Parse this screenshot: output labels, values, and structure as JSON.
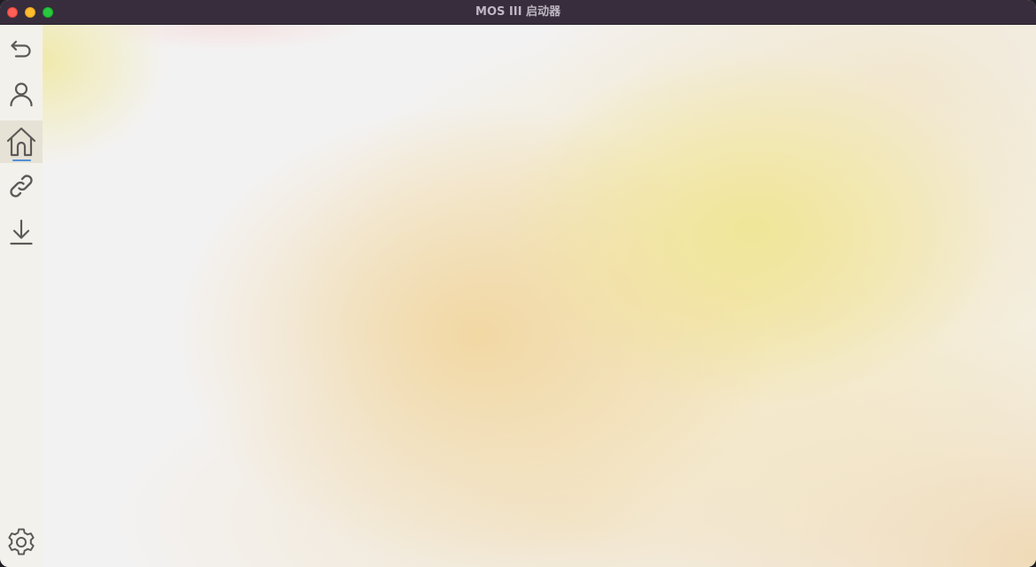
{
  "window": {
    "title": "MOS III 启动器"
  },
  "traffic_lights": {
    "close": "close-window",
    "minimize": "minimize-window",
    "zoom": "zoom-window"
  },
  "sidebar": {
    "items": [
      {
        "id": "back",
        "icon": "undo-arrow-icon",
        "active": false
      },
      {
        "id": "account",
        "icon": "user-icon",
        "active": false
      },
      {
        "id": "home",
        "icon": "home-icon",
        "active": true
      },
      {
        "id": "links",
        "icon": "link-icon",
        "active": false
      },
      {
        "id": "downloads",
        "icon": "download-icon",
        "active": false
      }
    ],
    "bottom_item": {
      "id": "settings",
      "icon": "gear-icon"
    }
  },
  "colors": {
    "titlebar": "#372d3c",
    "title_text": "#bfb7c3",
    "icon_stroke": "#5c5a58",
    "active_bg": "#e6e2d6",
    "active_indicator": "#4f8fd6"
  }
}
